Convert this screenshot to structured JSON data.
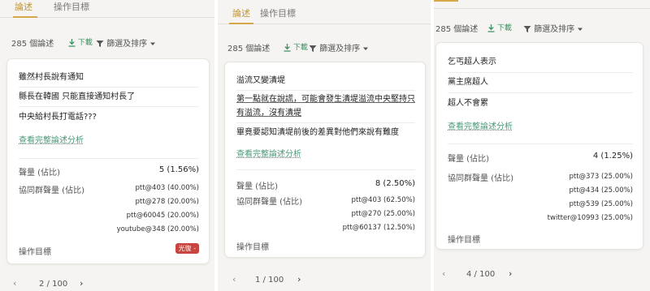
{
  "panel1": {
    "tabs": [
      "論述",
      "操作目標"
    ],
    "toolbar": {
      "count": "285 個論述",
      "download": "下載",
      "filter": "篩選及排序"
    },
    "quotes": [
      "雖然村長說有通知",
      "縣長在韓國 只能直接通知村長了",
      "中央給村長打電話???"
    ],
    "more_link": "查看完整論述分析",
    "volume_label": "聲量 (佔比)",
    "volume_value": "5 (1.56%)",
    "group_label": "協同群聲量 (佔比)",
    "group_values": [
      "ptt@403 (40.00%)",
      "ptt@278 (20.00%)",
      "ptt@60045 (20.00%)",
      "youtube@348 (20.00%)"
    ],
    "target_label": "操作目標",
    "target_badge": "光復 -",
    "pager": "2 / 100"
  },
  "panel2": {
    "tabs": [
      "論述",
      "操作目標"
    ],
    "toolbar": {
      "count": "285 個論述",
      "download": "下載",
      "filter": "篩選及排序"
    },
    "quotes": [
      "溢流又變潰堤",
      "第一點就在說謊，可能會發生潰堤溢流中央堅持只有溢流，沒有潰堤",
      "畢竟要認知潰堤前後的差異對他們來說有難度"
    ],
    "more_link": "查看完整論述分析",
    "volume_label": "聲量 (佔比)",
    "volume_value": "8 (2.50%)",
    "group_label": "協同群聲量 (佔比)",
    "group_values": [
      "ptt@403 (62.50%)",
      "ptt@270 (25.00%)",
      "ptt@60137 (12.50%)"
    ],
    "target_label": "操作目標",
    "pager": "1 / 100"
  },
  "panel3": {
    "toolbar": {
      "count": "285 個論述",
      "download": "下載",
      "filter": "篩選及排序"
    },
    "quotes": [
      "乞丐超人表示",
      "黨主席超人",
      "超人不會累"
    ],
    "more_link": "查看完整論述分析",
    "volume_label": "聲量 (佔比)",
    "volume_value": "4 (1.25%)",
    "group_label": "協同群聲量 (佔比)",
    "group_values": [
      "ptt@373 (25.00%)",
      "ptt@434 (25.00%)",
      "ptt@539 (25.00%)",
      "twitter@10993 (25.00%)"
    ],
    "target_label": "操作目標",
    "pager": "4 / 100"
  },
  "colors": {
    "accent": "#d6a84a",
    "link": "#4a9b7a",
    "badge": "#c9443f"
  },
  "icons": {
    "download": "download-icon",
    "filter": "filter-icon",
    "caret": "caret-down-icon",
    "prev": "chevron-left-icon",
    "next": "chevron-right-icon"
  }
}
